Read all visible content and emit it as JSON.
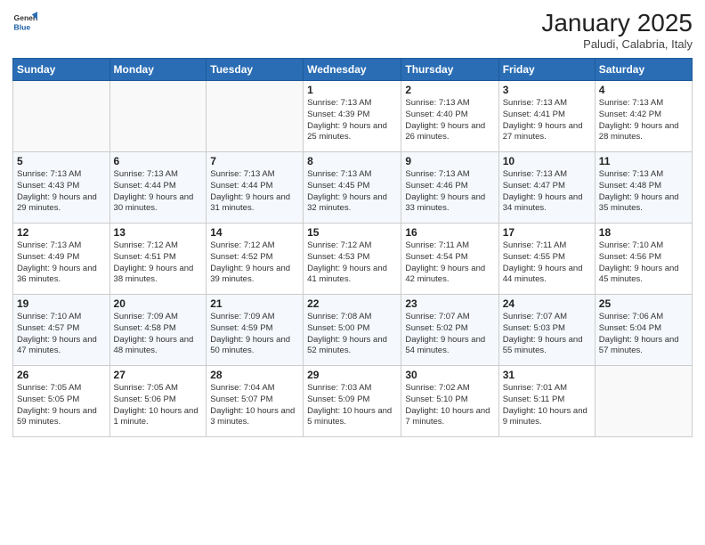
{
  "header": {
    "logo_line1": "General",
    "logo_line2": "Blue",
    "month": "January 2025",
    "location": "Paludi, Calabria, Italy"
  },
  "weekdays": [
    "Sunday",
    "Monday",
    "Tuesday",
    "Wednesday",
    "Thursday",
    "Friday",
    "Saturday"
  ],
  "weeks": [
    [
      {
        "day": "",
        "info": ""
      },
      {
        "day": "",
        "info": ""
      },
      {
        "day": "",
        "info": ""
      },
      {
        "day": "1",
        "info": "Sunrise: 7:13 AM\nSunset: 4:39 PM\nDaylight: 9 hours and 25 minutes."
      },
      {
        "day": "2",
        "info": "Sunrise: 7:13 AM\nSunset: 4:40 PM\nDaylight: 9 hours and 26 minutes."
      },
      {
        "day": "3",
        "info": "Sunrise: 7:13 AM\nSunset: 4:41 PM\nDaylight: 9 hours and 27 minutes."
      },
      {
        "day": "4",
        "info": "Sunrise: 7:13 AM\nSunset: 4:42 PM\nDaylight: 9 hours and 28 minutes."
      }
    ],
    [
      {
        "day": "5",
        "info": "Sunrise: 7:13 AM\nSunset: 4:43 PM\nDaylight: 9 hours and 29 minutes."
      },
      {
        "day": "6",
        "info": "Sunrise: 7:13 AM\nSunset: 4:44 PM\nDaylight: 9 hours and 30 minutes."
      },
      {
        "day": "7",
        "info": "Sunrise: 7:13 AM\nSunset: 4:44 PM\nDaylight: 9 hours and 31 minutes."
      },
      {
        "day": "8",
        "info": "Sunrise: 7:13 AM\nSunset: 4:45 PM\nDaylight: 9 hours and 32 minutes."
      },
      {
        "day": "9",
        "info": "Sunrise: 7:13 AM\nSunset: 4:46 PM\nDaylight: 9 hours and 33 minutes."
      },
      {
        "day": "10",
        "info": "Sunrise: 7:13 AM\nSunset: 4:47 PM\nDaylight: 9 hours and 34 minutes."
      },
      {
        "day": "11",
        "info": "Sunrise: 7:13 AM\nSunset: 4:48 PM\nDaylight: 9 hours and 35 minutes."
      }
    ],
    [
      {
        "day": "12",
        "info": "Sunrise: 7:13 AM\nSunset: 4:49 PM\nDaylight: 9 hours and 36 minutes."
      },
      {
        "day": "13",
        "info": "Sunrise: 7:12 AM\nSunset: 4:51 PM\nDaylight: 9 hours and 38 minutes."
      },
      {
        "day": "14",
        "info": "Sunrise: 7:12 AM\nSunset: 4:52 PM\nDaylight: 9 hours and 39 minutes."
      },
      {
        "day": "15",
        "info": "Sunrise: 7:12 AM\nSunset: 4:53 PM\nDaylight: 9 hours and 41 minutes."
      },
      {
        "day": "16",
        "info": "Sunrise: 7:11 AM\nSunset: 4:54 PM\nDaylight: 9 hours and 42 minutes."
      },
      {
        "day": "17",
        "info": "Sunrise: 7:11 AM\nSunset: 4:55 PM\nDaylight: 9 hours and 44 minutes."
      },
      {
        "day": "18",
        "info": "Sunrise: 7:10 AM\nSunset: 4:56 PM\nDaylight: 9 hours and 45 minutes."
      }
    ],
    [
      {
        "day": "19",
        "info": "Sunrise: 7:10 AM\nSunset: 4:57 PM\nDaylight: 9 hours and 47 minutes."
      },
      {
        "day": "20",
        "info": "Sunrise: 7:09 AM\nSunset: 4:58 PM\nDaylight: 9 hours and 48 minutes."
      },
      {
        "day": "21",
        "info": "Sunrise: 7:09 AM\nSunset: 4:59 PM\nDaylight: 9 hours and 50 minutes."
      },
      {
        "day": "22",
        "info": "Sunrise: 7:08 AM\nSunset: 5:00 PM\nDaylight: 9 hours and 52 minutes."
      },
      {
        "day": "23",
        "info": "Sunrise: 7:07 AM\nSunset: 5:02 PM\nDaylight: 9 hours and 54 minutes."
      },
      {
        "day": "24",
        "info": "Sunrise: 7:07 AM\nSunset: 5:03 PM\nDaylight: 9 hours and 55 minutes."
      },
      {
        "day": "25",
        "info": "Sunrise: 7:06 AM\nSunset: 5:04 PM\nDaylight: 9 hours and 57 minutes."
      }
    ],
    [
      {
        "day": "26",
        "info": "Sunrise: 7:05 AM\nSunset: 5:05 PM\nDaylight: 9 hours and 59 minutes."
      },
      {
        "day": "27",
        "info": "Sunrise: 7:05 AM\nSunset: 5:06 PM\nDaylight: 10 hours and 1 minute."
      },
      {
        "day": "28",
        "info": "Sunrise: 7:04 AM\nSunset: 5:07 PM\nDaylight: 10 hours and 3 minutes."
      },
      {
        "day": "29",
        "info": "Sunrise: 7:03 AM\nSunset: 5:09 PM\nDaylight: 10 hours and 5 minutes."
      },
      {
        "day": "30",
        "info": "Sunrise: 7:02 AM\nSunset: 5:10 PM\nDaylight: 10 hours and 7 minutes."
      },
      {
        "day": "31",
        "info": "Sunrise: 7:01 AM\nSunset: 5:11 PM\nDaylight: 10 hours and 9 minutes."
      },
      {
        "day": "",
        "info": ""
      }
    ]
  ]
}
